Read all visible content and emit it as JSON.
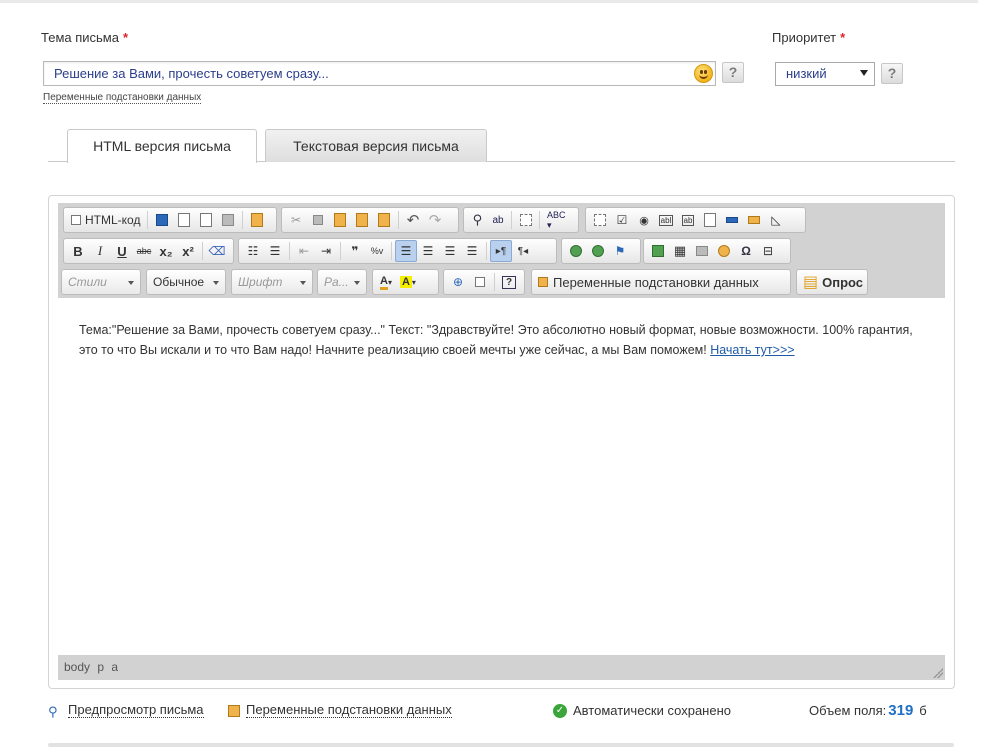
{
  "subject": {
    "label": "Тема письма",
    "required_mark": "*",
    "value": "Решение за Вами, прочесть советуем сразу...",
    "help": "?",
    "vars_link": "Переменные подстановки данных"
  },
  "priority": {
    "label": "Приоритет",
    "required_mark": "*",
    "value": "низкий",
    "help": "?"
  },
  "tabs": [
    {
      "label": "HTML версия письма",
      "active": true
    },
    {
      "label": "Текстовая версия письма",
      "active": false
    }
  ],
  "toolbar": {
    "html_code": "HTML-код",
    "bold": "B",
    "italic": "I",
    "underline": "U",
    "strike": "abc",
    "subscript": "x₂",
    "superscript": "x²",
    "styles": "Стили",
    "format": "Обычное",
    "font": "Шрифт",
    "size": "Ра...",
    "help": "?",
    "vars_button": "Переменные подстановки данных",
    "poll_button": "Опрос"
  },
  "editor": {
    "text": "Тема:\"Решение за Вами, прочесть советуем сразу...\" Текст: \"Здравствуйте! Это абсолютно новый формат, новые возможности. 100% гарантия, это то что Вы искали и то что Вам надо! Начните реализацию своей мечты уже сейчас, а мы Вам поможем! ",
    "link": "Начать тут>>>",
    "path": "body p a"
  },
  "footer": {
    "preview": "Предпросмотр письма",
    "vars": "Переменные подстановки данных",
    "autosave": "Автоматически сохранено",
    "volume_label": "Объем поля:",
    "volume_value": "319",
    "volume_unit": "б"
  }
}
